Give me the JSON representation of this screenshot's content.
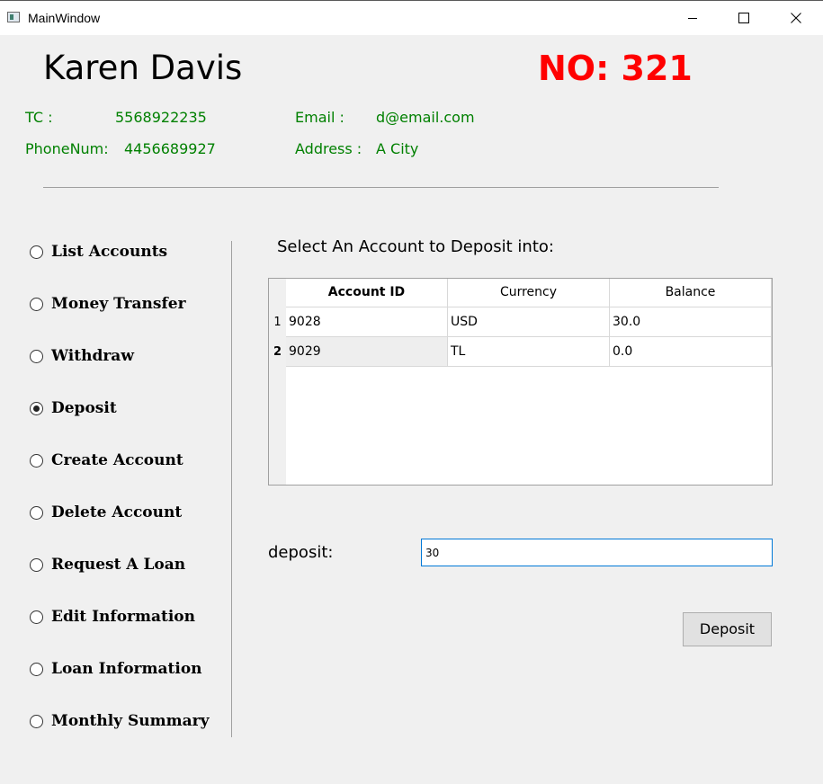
{
  "window": {
    "title": "MainWindow"
  },
  "customer": {
    "name": "Karen Davis",
    "number_label": "NO: 321",
    "tc_label": "TC :",
    "tc_value": "5568922235",
    "phone_label": "PhoneNum:",
    "phone_value": "4456689927",
    "email_label": "Email :",
    "email_value": "d@email.com",
    "address_label": "Address :",
    "address_value": "A City"
  },
  "menu": {
    "items": [
      {
        "label": "List Accounts",
        "checked": false
      },
      {
        "label": "Money Transfer",
        "checked": false
      },
      {
        "label": "Withdraw",
        "checked": false
      },
      {
        "label": "Deposit",
        "checked": true
      },
      {
        "label": "Create Account",
        "checked": false
      },
      {
        "label": "Delete Account",
        "checked": false
      },
      {
        "label": "Request A Loan",
        "checked": false
      },
      {
        "label": "Edit Information",
        "checked": false
      },
      {
        "label": "Loan Information",
        "checked": false
      },
      {
        "label": "Monthly Summary",
        "checked": false
      }
    ]
  },
  "deposit_panel": {
    "title": "Select An Account to Deposit into:",
    "table": {
      "columns": [
        "Account ID",
        "Currency",
        "Balance"
      ],
      "row_numbers": [
        "1",
        "2"
      ],
      "rows": [
        [
          "9028",
          "USD",
          "30.0"
        ],
        [
          "9029",
          "TL",
          "0.0"
        ]
      ]
    },
    "amount_label": "deposit:",
    "amount_value": "30",
    "button_label": "Deposit"
  },
  "colors": {
    "accent_number": "#ff0000",
    "info_text": "#008000",
    "input_focus": "#0078d7"
  }
}
